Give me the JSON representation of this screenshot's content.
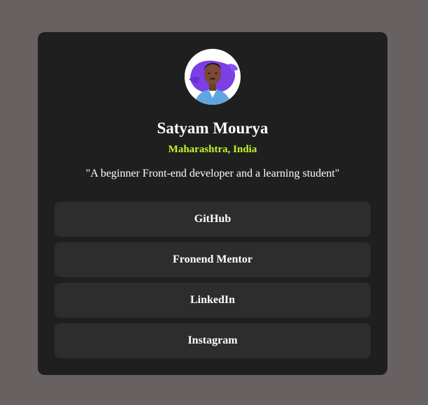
{
  "profile": {
    "name": "Satyam Mourya",
    "location": "Maharashtra, India",
    "bio": "\"A beginner Front-end developer and a learning student\"",
    "avatar_icon": "profile-photo"
  },
  "links": [
    {
      "label": "GitHub"
    },
    {
      "label": "Fronend Mentor"
    },
    {
      "label": "LinkedIn"
    },
    {
      "label": "Instagram"
    }
  ],
  "colors": {
    "page_background": "#676162",
    "card_background": "#1f1f1f",
    "button_background": "#2d2d2d",
    "accent": "#c3f42b",
    "text": "#ffffff"
  }
}
